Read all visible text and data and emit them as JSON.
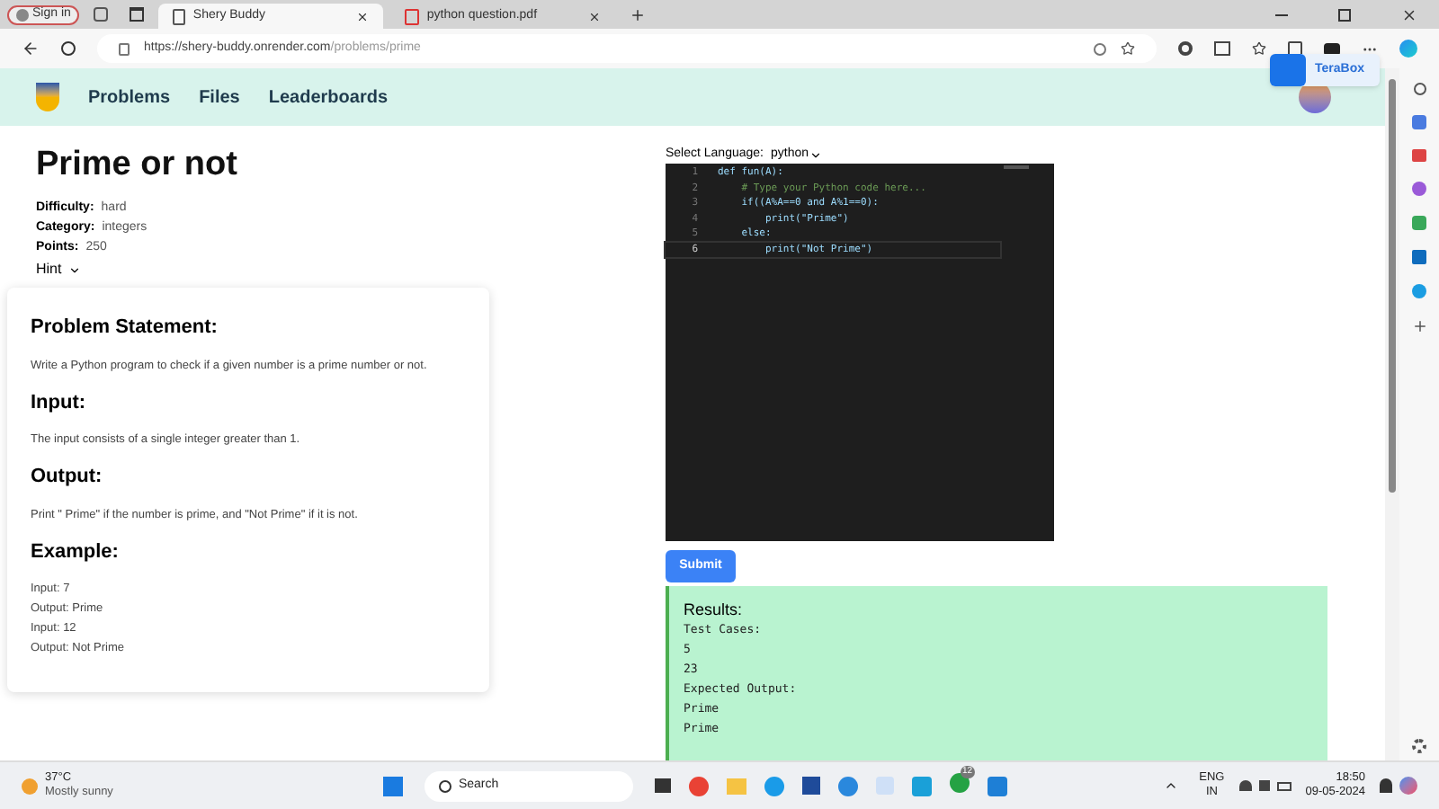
{
  "browser": {
    "sign_in": "Sign in",
    "tabs": [
      {
        "title": "Shery Buddy",
        "selected": true,
        "kind": "page"
      },
      {
        "title": "python question.pdf",
        "selected": false,
        "kind": "pdf"
      }
    ],
    "url_host": "https://shery-buddy.onrender.com",
    "url_path": "/problems/prime",
    "extension_popup": "TeraBox"
  },
  "nav": {
    "links": [
      "Problems",
      "Files",
      "Leaderboards"
    ]
  },
  "problem": {
    "title": "Prime or not",
    "meta": [
      {
        "label": "Difficulty:",
        "value": "hard"
      },
      {
        "label": "Category:",
        "value": "integers"
      },
      {
        "label": "Points:",
        "value": "250"
      }
    ],
    "hint": "Hint",
    "sections": [
      {
        "heading": "Problem Statement:",
        "lines": [
          "Write a Python program to check if a given number is a prime number or not."
        ]
      },
      {
        "heading": "Input:",
        "lines": [
          "The input consists of a single integer greater than 1."
        ]
      },
      {
        "heading": "Output:",
        "lines": [
          "Print \" Prime\" if the number is prime, and \"Not Prime\" if it is not."
        ]
      },
      {
        "heading": "Example:",
        "lines": [
          "Input: 7",
          "Output: Prime",
          "Input: 12",
          "Output: Not Prime"
        ]
      }
    ]
  },
  "editor": {
    "language_label": "Select Language:",
    "language": "python",
    "lines": [
      {
        "number": "1",
        "text": "def fun(A):",
        "kind": "code",
        "current": false
      },
      {
        "number": "2",
        "text": "    # Type your Python code here...",
        "kind": "comment",
        "current": false
      },
      {
        "number": "3",
        "text": "    if((A%A==0 and A%1==0):",
        "kind": "code",
        "current": false
      },
      {
        "number": "4",
        "text": "        print(\"Prime\")",
        "kind": "code",
        "current": false
      },
      {
        "number": "5",
        "text": "    else:",
        "kind": "code",
        "current": false
      },
      {
        "number": "6",
        "text": "        print(\"Not Prime\")",
        "kind": "code",
        "current": true
      }
    ]
  },
  "submit": "Submit",
  "results": {
    "title": "Results:",
    "lines": [
      "Test Cases:",
      "5",
      "23",
      "Expected Output:",
      "Prime",
      "Prime"
    ]
  },
  "taskbar": {
    "temperature": "37°C",
    "weather": "Mostly sunny",
    "search": "Search",
    "whatsapp_badge": "12",
    "lang": "ENG",
    "region": "IN",
    "time": "18:50",
    "date": "09-05-2024"
  }
}
